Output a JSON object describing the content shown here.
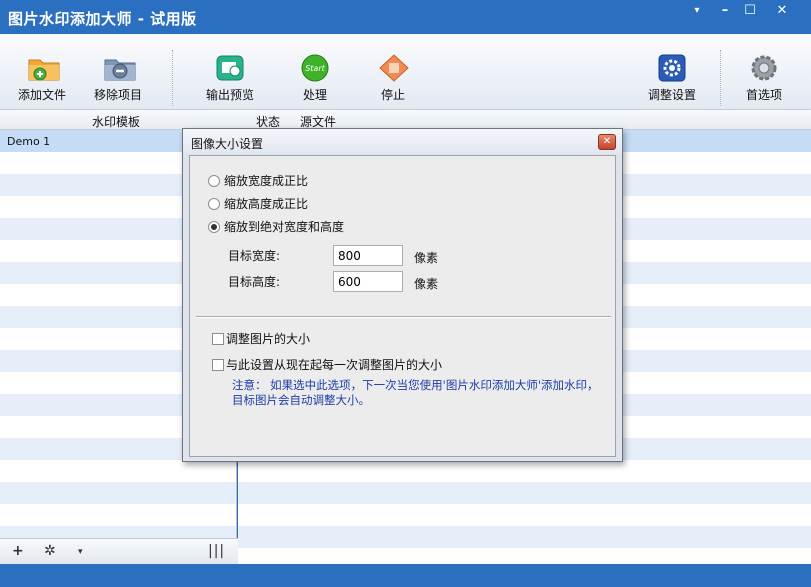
{
  "window": {
    "title": "图片水印添加大师 - 试用版",
    "controls": {
      "dropdown": "▾",
      "minimize": "–",
      "maximize": "☐",
      "close": "✕"
    }
  },
  "toolbar": {
    "add_files": "添加文件",
    "remove_item": "移除项目",
    "output_preview": "输出预览",
    "process": "处理",
    "process_icon_text": "Start",
    "stop": "停止",
    "adjust_settings": "调整设置",
    "preferences": "首选项"
  },
  "columns": {
    "watermark_template": "水印模板",
    "status": "状态",
    "source_file": "源文件"
  },
  "templates": [
    {
      "name": "Demo 1"
    }
  ],
  "left_bar": {
    "add": "+",
    "settings": "✲",
    "dropdown": "▾",
    "columns": "|||"
  },
  "dialog": {
    "title": "图像大小设置",
    "close": "✕",
    "options": [
      {
        "label": "缩放宽度成正比",
        "selected": false
      },
      {
        "label": "缩放高度成正比",
        "selected": false
      },
      {
        "label": "缩放到绝对宽度和高度",
        "selected": true
      }
    ],
    "width_label": "目标宽度:",
    "width_value": "800",
    "height_label": "目标高度:",
    "height_value": "600",
    "unit": "像素",
    "resize_check": "调整图片的大小",
    "always_check": "与此设置从现在起每一次调整图片的大小",
    "note": "注意： 如果选中此选项，下一次当您使用'图片水印添加大师'添加水印，目标图片会自动调整大小。"
  },
  "colors": {
    "title_bar": "#2a6fc0",
    "selected_row": "#c5dcf6",
    "alt_row": "#e6eef9",
    "note_text": "#1a3ea8"
  }
}
